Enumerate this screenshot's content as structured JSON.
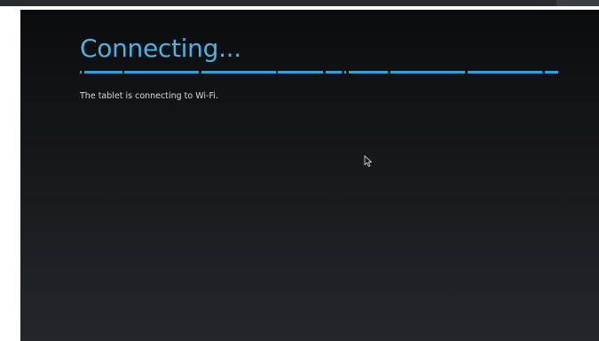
{
  "screen": {
    "title": "Connecting...",
    "message": "The tablet is connecting to Wi-Fi."
  },
  "icons": {
    "cursor": "mouse-pointer-icon"
  },
  "colors": {
    "accent": "#4fb0e2",
    "progress": "#3a9fd9",
    "text": "#d8dadc",
    "background_top": "#0b0c0e",
    "background_bottom": "#23272b"
  }
}
